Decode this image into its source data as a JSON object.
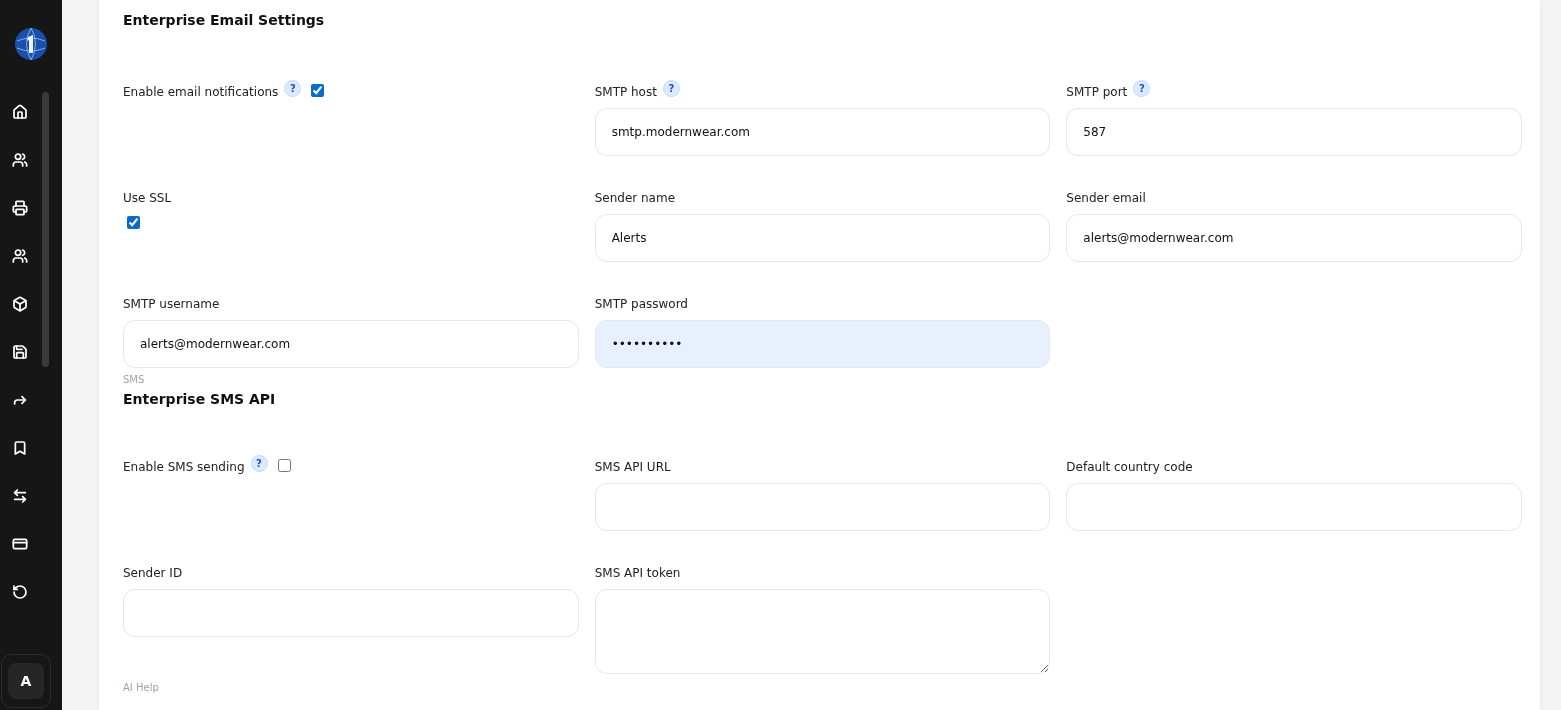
{
  "sidebar": {
    "avatar": "A"
  },
  "sections": [
    {
      "heading": "Enterprise Email Settings",
      "fields": [
        {
          "kind": "checkbox_inline",
          "label": "Enable email notifications",
          "help": "?",
          "checked": true
        },
        {
          "kind": "text",
          "label": "SMTP host",
          "help": "?",
          "value": "smtp.modernwear.com"
        },
        {
          "kind": "text",
          "label": "SMTP port",
          "help": "?",
          "value": "587"
        },
        {
          "kind": "checkbox",
          "label": "Use SSL",
          "checked": true
        },
        {
          "kind": "text",
          "label": "Sender name",
          "value": "Alerts"
        },
        {
          "kind": "text",
          "label": "Sender email",
          "value": "alerts@modernwear.com"
        },
        {
          "kind": "text",
          "label": "SMTP username",
          "value": "alerts@modernwear.com"
        },
        {
          "kind": "password",
          "label": "SMTP password",
          "value": "••••••••••"
        }
      ]
    },
    {
      "caption": "SMS",
      "heading": "Enterprise SMS API",
      "fields": [
        {
          "kind": "checkbox_inline",
          "label": "Enable SMS sending",
          "help": "?",
          "checked": false
        },
        {
          "kind": "text",
          "label": "SMS API URL"
        },
        {
          "kind": "text",
          "label": "Default country code"
        },
        {
          "kind": "text",
          "label": "Sender ID"
        },
        {
          "kind": "textarea",
          "label": "SMS API token"
        }
      ]
    }
  ],
  "footer_caption": "AI Help"
}
